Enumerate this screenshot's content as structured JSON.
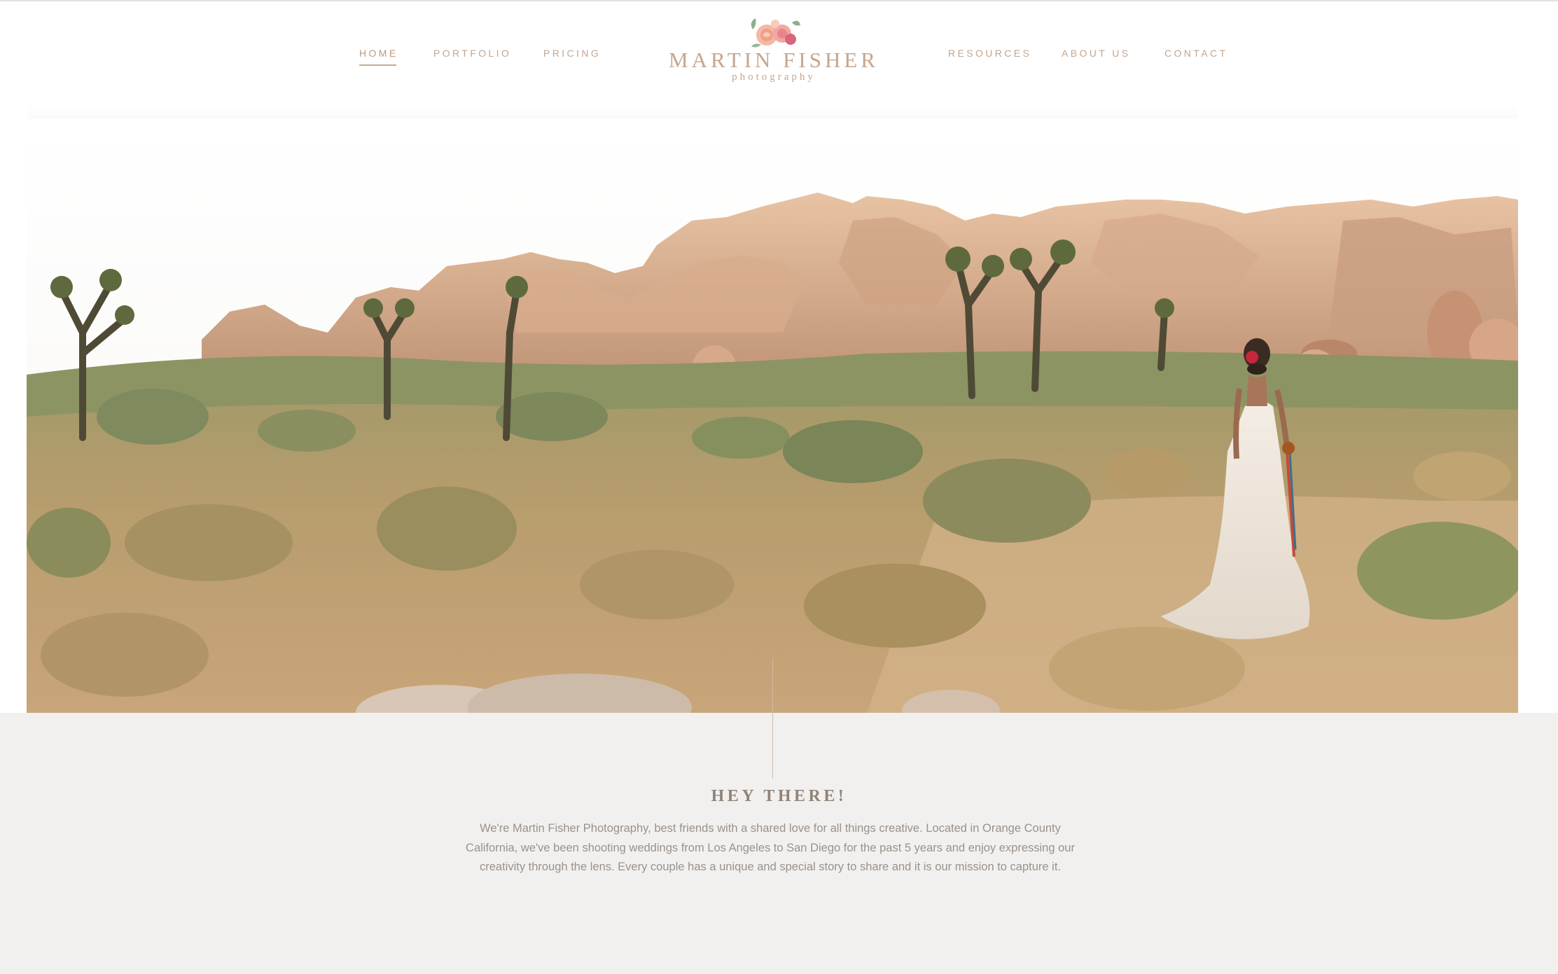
{
  "nav": {
    "left": [
      {
        "label": "HOME",
        "active": true
      },
      {
        "label": "PORTFOLIO",
        "active": false
      },
      {
        "label": "PRICING",
        "active": false
      }
    ],
    "right": [
      {
        "label": "RESOURCES",
        "active": false
      },
      {
        "label": "ABOUT US",
        "active": false
      },
      {
        "label": "CONTACT",
        "active": false
      }
    ]
  },
  "logo": {
    "title": "MARTIN FISHER",
    "subtitle": "photography",
    "icon": "flower-bouquet-icon"
  },
  "hero": {
    "image": "bride-in-desert-photo"
  },
  "about": {
    "heading": "HEY THERE!",
    "body": "We're Martin Fisher Photography, best friends with a shared love for all things creative. Located in Orange County California, we've been shooting weddings from Los Angeles to San Diego for the past 5 years and enjoy expressing our creativity through the lens. Every couple has a unique and special story to share and it is our mission to capture it."
  },
  "colors": {
    "accent": "#c6a58c",
    "section_bg": "#f2f0ee",
    "text": "#9b918a"
  }
}
